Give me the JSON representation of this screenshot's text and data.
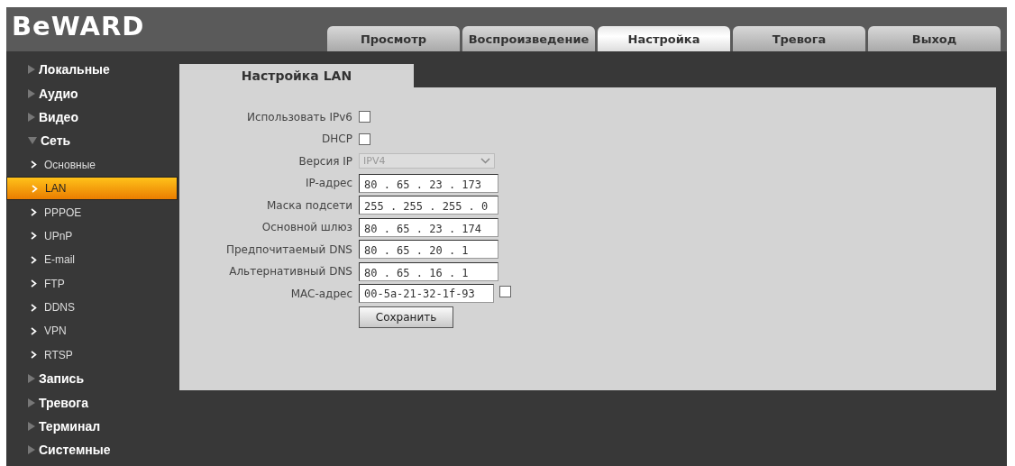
{
  "logo": "BeWARD",
  "tabs": [
    {
      "label": "Просмотр",
      "selected": false
    },
    {
      "label": "Воспроизведение",
      "selected": false
    },
    {
      "label": "Настройка",
      "selected": true
    },
    {
      "label": "Тревога",
      "selected": false
    },
    {
      "label": "Выход",
      "selected": false
    }
  ],
  "sidebar": {
    "items": [
      {
        "label": "Локальные",
        "expanded": false
      },
      {
        "label": "Аудио",
        "expanded": false
      },
      {
        "label": "Видео",
        "expanded": false
      },
      {
        "label": "Сеть",
        "expanded": true,
        "children": [
          {
            "label": "Основные",
            "selected": false
          },
          {
            "label": "LAN",
            "selected": true
          },
          {
            "label": "PPPOE",
            "selected": false
          },
          {
            "label": "UPnP",
            "selected": false
          },
          {
            "label": "E-mail",
            "selected": false
          },
          {
            "label": "FTP",
            "selected": false
          },
          {
            "label": "DDNS",
            "selected": false
          },
          {
            "label": "VPN",
            "selected": false
          },
          {
            "label": "RTSP",
            "selected": false
          }
        ]
      },
      {
        "label": "Запись",
        "expanded": false
      },
      {
        "label": "Тревога",
        "expanded": false
      },
      {
        "label": "Терминал",
        "expanded": false
      },
      {
        "label": "Системные",
        "expanded": false
      }
    ]
  },
  "panel": {
    "title": "Настройка LAN",
    "fields": [
      {
        "kind": "checkbox",
        "label": "Использовать IPv6",
        "checked": false
      },
      {
        "kind": "checkbox",
        "label": "DHCP",
        "checked": false
      },
      {
        "kind": "select",
        "label": "Версия IP",
        "value": "IPV4",
        "disabled": true
      },
      {
        "kind": "ip",
        "label": "IP-адрес",
        "value": "80 . 65 . 23 . 173"
      },
      {
        "kind": "ip",
        "label": "Маска подсети",
        "value": "255 . 255 . 255 . 0"
      },
      {
        "kind": "ip",
        "label": "Основной шлюз",
        "value": "80 . 65 . 23 . 174"
      },
      {
        "kind": "ip",
        "label": "Предпочитаемый DNS",
        "value": "80 . 65 . 20 . 1"
      },
      {
        "kind": "ip",
        "label": "Альтернативный DNS",
        "value": "80 . 65 . 16 . 1"
      },
      {
        "kind": "mac",
        "label": "MAC-адрес",
        "value": "00-5a-21-32-1f-93",
        "checked": false
      }
    ],
    "save_button": "Сохранить"
  }
}
